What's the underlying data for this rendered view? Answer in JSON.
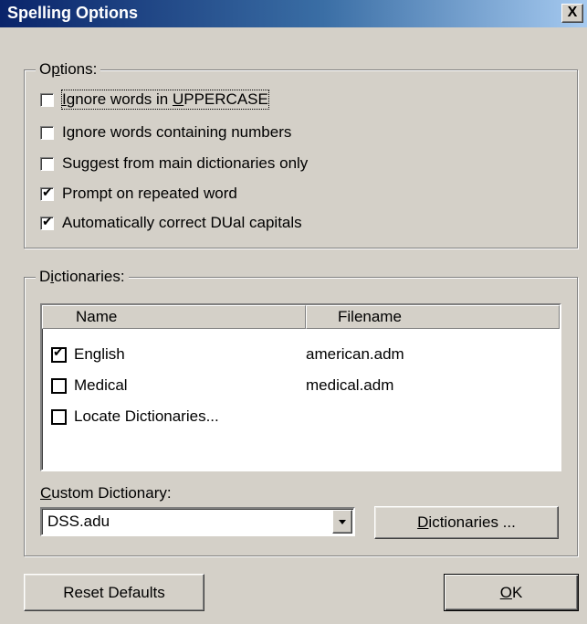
{
  "window": {
    "title": "Spelling Options",
    "close_glyph": "X"
  },
  "options": {
    "legend": {
      "pre": "O",
      "ul": "p",
      "post": "tions:"
    },
    "items": [
      {
        "pre": "",
        "ul": "I",
        "post": "gnore words in ",
        "ul2": "U",
        "post2": "PPERCASE",
        "checked": false,
        "focused": true
      },
      {
        "label": "Ignore words containing numbers",
        "checked": false
      },
      {
        "label": "Suggest from main dictionaries only",
        "checked": false
      },
      {
        "label": "Prompt on repeated word",
        "checked": true
      },
      {
        "label": "Automatically correct DUal capitals",
        "checked": true
      }
    ]
  },
  "dictionaries": {
    "legend": {
      "pre": "D",
      "ul": "i",
      "post": "ctionaries:"
    },
    "columns": {
      "name": "Name",
      "filename": "Filename"
    },
    "rows": [
      {
        "name": "English",
        "filename": "american.adm",
        "checked": true
      },
      {
        "name": "Medical",
        "filename": "medical.adm",
        "checked": false
      },
      {
        "name": "Locate Dictionaries...",
        "filename": "",
        "checked": false
      }
    ],
    "custom_label": {
      "ul": "C",
      "post": "ustom Dictionary:"
    },
    "custom_value": "DSS.adu",
    "dicts_button": {
      "ul": "D",
      "post": "ictionaries ..."
    }
  },
  "footer": {
    "reset_label": "Reset Defaults",
    "ok_label": {
      "ul": "O",
      "post": "K"
    }
  }
}
